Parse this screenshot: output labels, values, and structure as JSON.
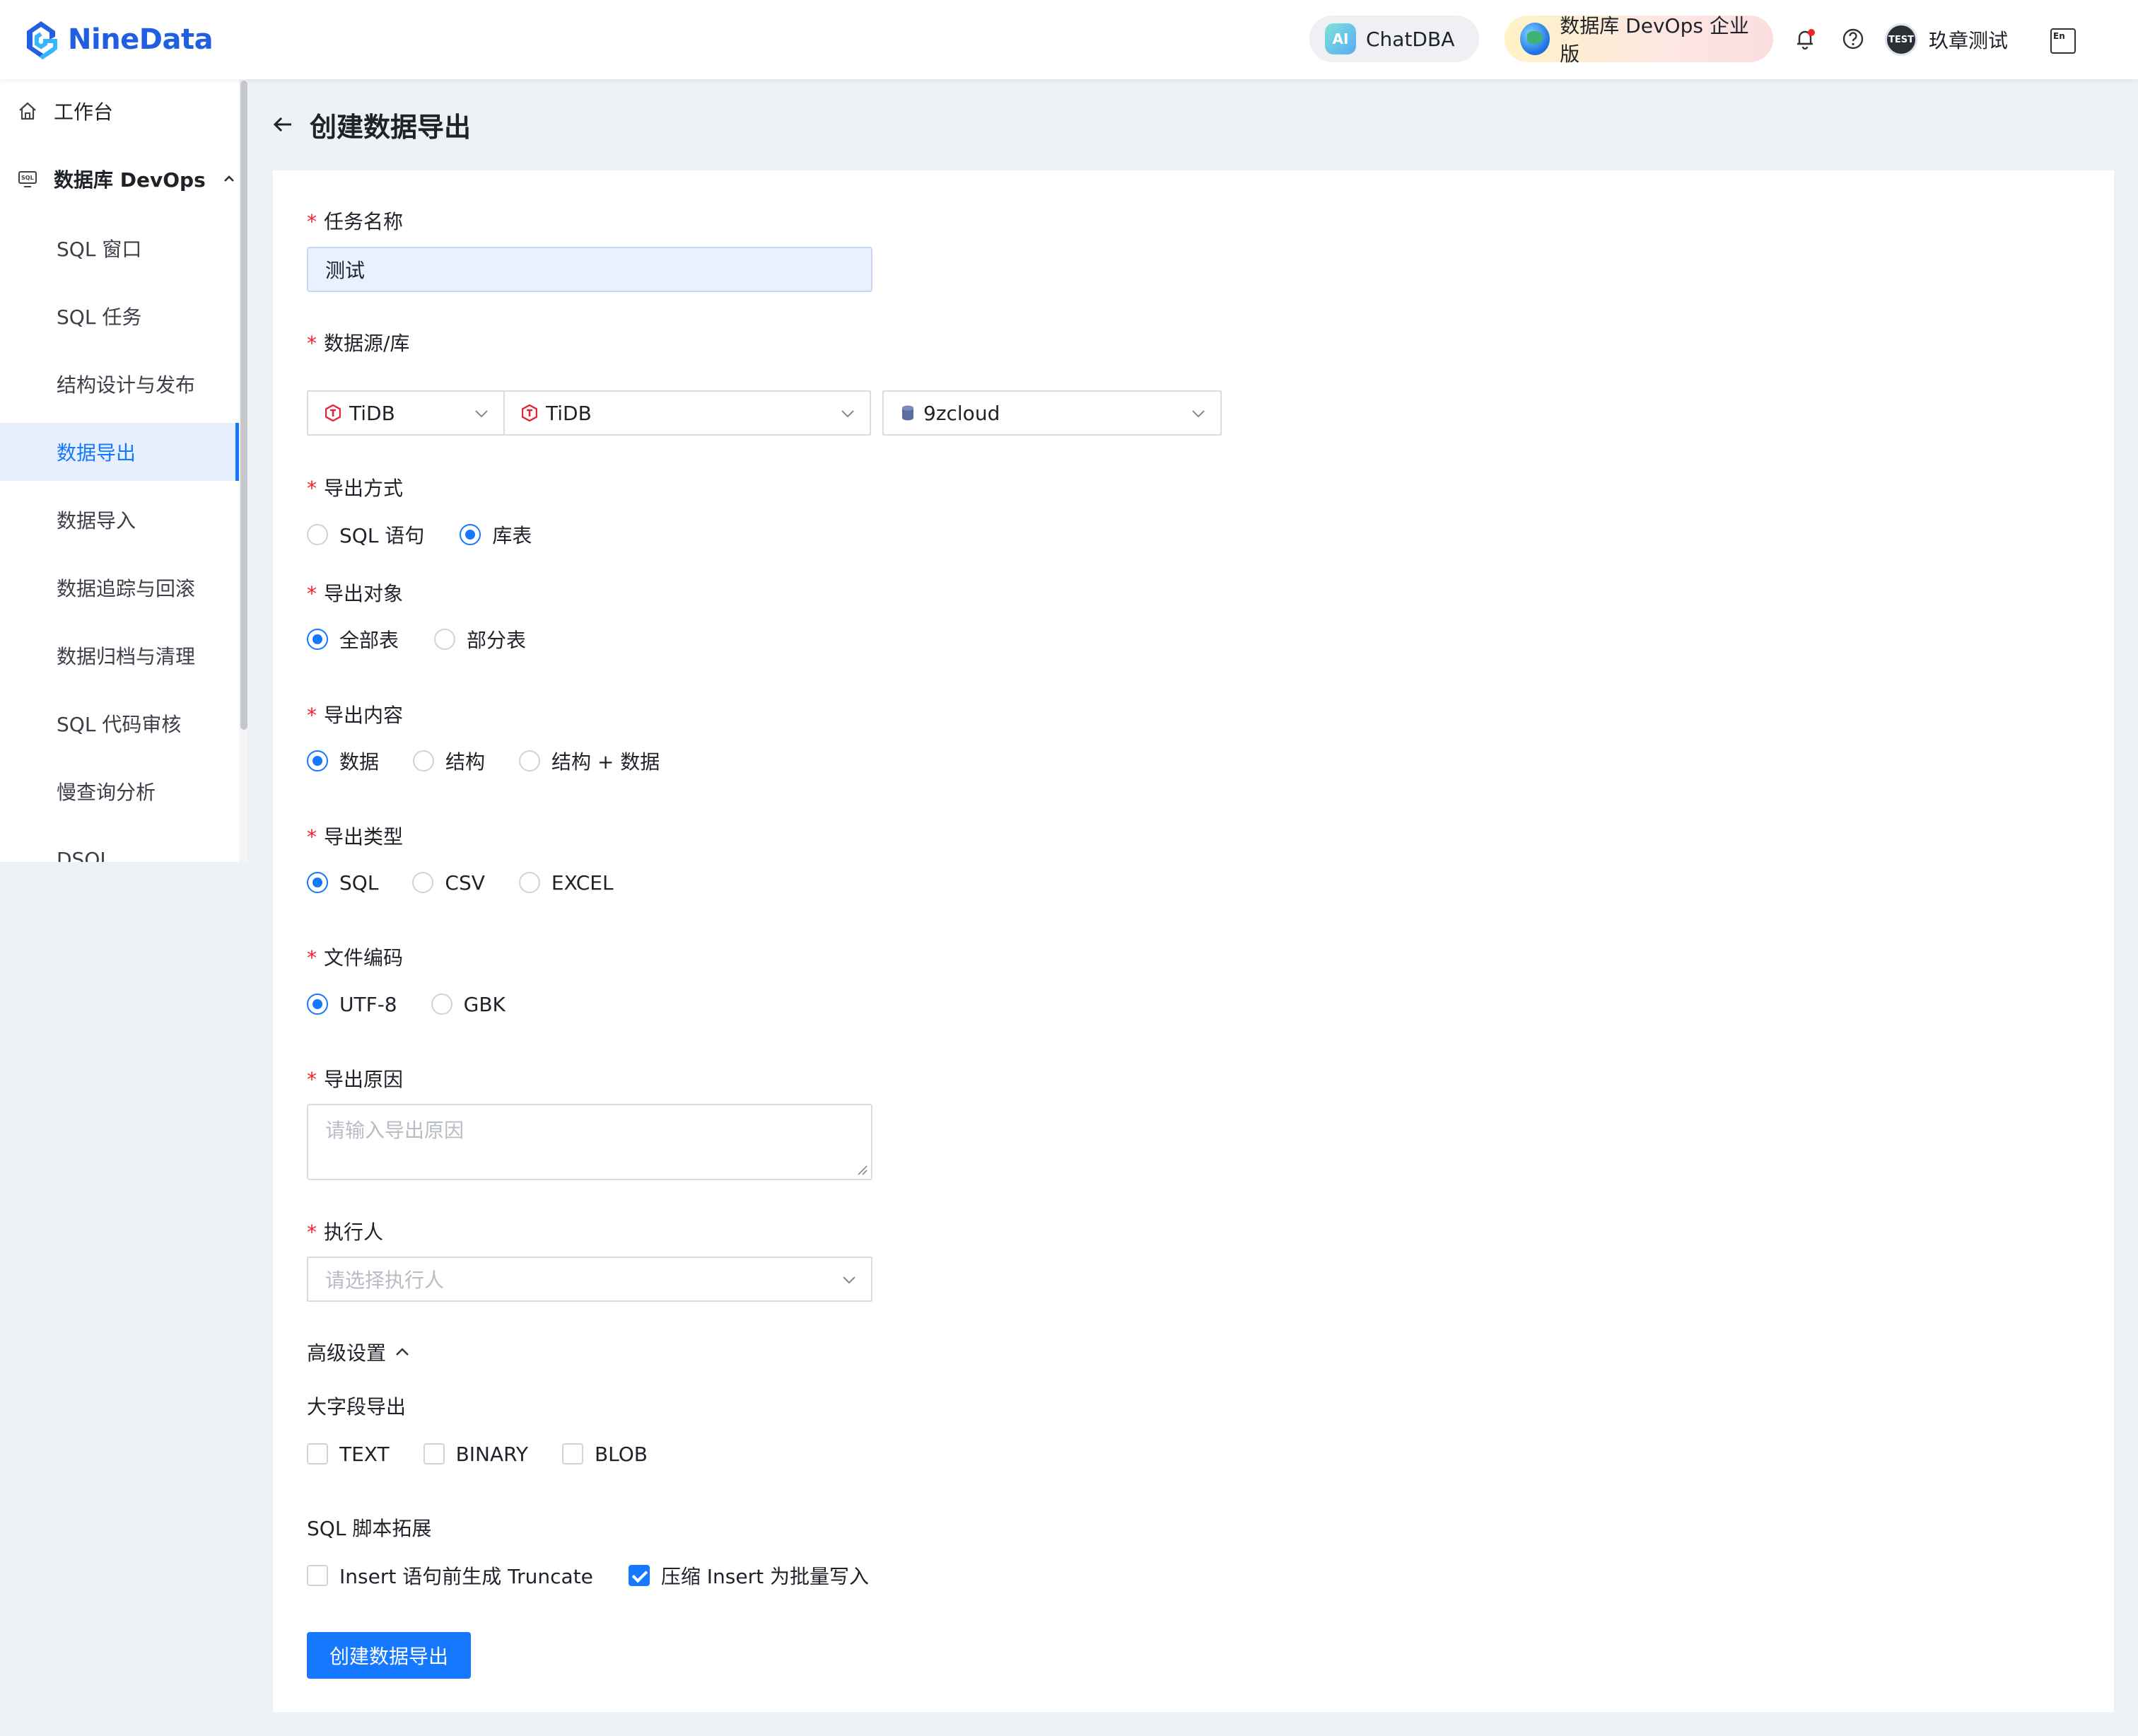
{
  "header": {
    "brand": "NineData",
    "chatdba_label": "ChatDBA",
    "ai_badge": "AI",
    "devops_label": "数据库 DevOps 企业版",
    "user_badge": "TEST",
    "user_name": "玖章测试",
    "lang_badge": "En"
  },
  "sidebar": {
    "workbench": "工作台",
    "group": "数据库 DevOps",
    "items": [
      {
        "label": "SQL 窗口"
      },
      {
        "label": "SQL 任务"
      },
      {
        "label": "结构设计与发布"
      },
      {
        "label": "数据导出"
      },
      {
        "label": "数据导入"
      },
      {
        "label": "数据追踪与回滚"
      },
      {
        "label": "数据归档与清理"
      },
      {
        "label": "SQL 代码审核"
      },
      {
        "label": "慢查询分析"
      },
      {
        "label": "DSQL"
      }
    ],
    "active_item": "数据导出"
  },
  "page": {
    "title": "创建数据导出"
  },
  "form": {
    "task_name": {
      "label": "任务名称",
      "value": "测试"
    },
    "datasource": {
      "label": "数据源/库",
      "env": "TiDB",
      "instance": "TiDB",
      "database": "9zcloud"
    },
    "export_mode": {
      "label": "导出方式",
      "options": [
        "SQL 语句",
        "库表"
      ],
      "selected": "库表"
    },
    "export_object": {
      "label": "导出对象",
      "options": [
        "全部表",
        "部分表"
      ],
      "selected": "全部表"
    },
    "export_content": {
      "label": "导出内容",
      "options": [
        "数据",
        "结构",
        "结构 + 数据"
      ],
      "selected": "数据"
    },
    "export_type": {
      "label": "导出类型",
      "options": [
        "SQL",
        "CSV",
        "EXCEL"
      ],
      "selected": "SQL"
    },
    "file_encoding": {
      "label": "文件编码",
      "options": [
        "UTF-8",
        "GBK"
      ],
      "selected": "UTF-8"
    },
    "export_reason": {
      "label": "导出原因",
      "placeholder": "请输入导出原因",
      "value": ""
    },
    "executor": {
      "label": "执行人",
      "placeholder": "请选择执行人"
    },
    "advanced": {
      "toggle_label": "高级设置",
      "large_field": {
        "label": "大字段导出",
        "options": [
          {
            "label": "TEXT",
            "checked": false
          },
          {
            "label": "BINARY",
            "checked": false
          },
          {
            "label": "BLOB",
            "checked": false
          }
        ]
      },
      "sql_ext": {
        "label": "SQL 脚本拓展",
        "options": [
          {
            "label": "Insert 语句前生成 Truncate",
            "checked": false
          },
          {
            "label": "压缩 Insert 为批量写入",
            "checked": true
          }
        ]
      }
    },
    "submit_label": "创建数据导出"
  },
  "colors": {
    "primary": "#1677ff",
    "required": "#f5222d",
    "brand": "#1f5fe0",
    "tidb": "#e0263a"
  }
}
